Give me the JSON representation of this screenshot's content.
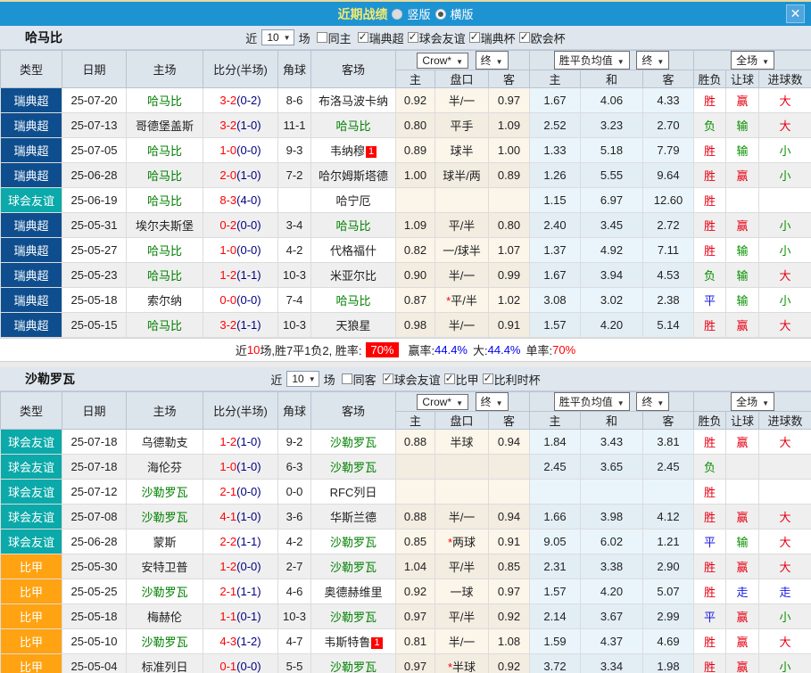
{
  "titlebar": {
    "title": "近期战绩",
    "vertical_label": "竖版",
    "horizontal_label": "横版",
    "selected_layout": "横版"
  },
  "icons": {
    "close": "✕",
    "dropdown_arrow": "▼",
    "checkbox_check": "✓"
  },
  "colors": {
    "bar_blue": "#1E93D2",
    "title_yellow": "#F5E96E",
    "section_bg": "#DFE6EE",
    "header_bg": "#DCE4EC",
    "red": "#FF0000",
    "blue": "#0000EE",
    "green": "#008000",
    "navy": "#000080"
  },
  "league_colors": {
    "瑞典超": "#0E4E8E",
    "球会友谊": "#0BA9A9",
    "比甲": "#FFA312"
  },
  "result_colors": {
    "胜": "#E60012",
    "平": "#1A1AE6",
    "负": "#089000",
    "赢": "#E60012",
    "输": "#089000",
    "走": "#1A1AE6",
    "大": "#E60012",
    "小": "#089000"
  },
  "sections": [
    {
      "team": "哈马比",
      "filter": {
        "near": "近",
        "count": "10",
        "games": "场",
        "same": "同主",
        "same_checked": false,
        "leagues": [
          "瑞典超",
          "球会友谊",
          "瑞典杯",
          "欧会杯"
        ],
        "leagues_checked": true
      },
      "header": {
        "cols": {
          "type": "类型",
          "date": "日期",
          "home": "主场",
          "score": "比分(半场)",
          "corner": "角球",
          "away": "客场"
        },
        "odds_source": "Crow*",
        "final": "终",
        "mean": "胜平负均值",
        "final2": "终",
        "full": "全场",
        "sub": {
          "oh": "主",
          "hc": "盘口",
          "oa": "客",
          "m1": "主",
          "m2": "和",
          "m3": "客",
          "r1": "胜负",
          "r2": "让球",
          "r3": "进球数"
        }
      },
      "rows": [
        {
          "league": "瑞典超",
          "date": "25-07-20",
          "home": "哈马比",
          "home_active": true,
          "score": "3-2",
          "half": "(0-2)",
          "corner": "8-6",
          "away": "布洛马波卡纳",
          "away_active": false,
          "away_badge": "",
          "odds": [
            "0.92",
            "半/一",
            "0.97"
          ],
          "means": [
            "1.67",
            "4.06",
            "4.33"
          ],
          "results": [
            "胜",
            "赢",
            "大"
          ]
        },
        {
          "league": "瑞典超",
          "date": "25-07-13",
          "home": "哥德堡盖斯",
          "home_active": false,
          "score": "3-2",
          "half": "(1-0)",
          "corner": "11-1",
          "away": "哈马比",
          "away_active": true,
          "away_badge": "",
          "odds": [
            "0.80",
            "平手",
            "1.09"
          ],
          "means": [
            "2.52",
            "3.23",
            "2.70"
          ],
          "results": [
            "负",
            "输",
            "大"
          ]
        },
        {
          "league": "瑞典超",
          "date": "25-07-05",
          "home": "哈马比",
          "home_active": true,
          "score": "1-0",
          "half": "(0-0)",
          "corner": "9-3",
          "away": "韦纳穆",
          "away_active": false,
          "away_badge": "1",
          "odds": [
            "0.89",
            "球半",
            "1.00"
          ],
          "means": [
            "1.33",
            "5.18",
            "7.79"
          ],
          "results": [
            "胜",
            "输",
            "小"
          ]
        },
        {
          "league": "瑞典超",
          "date": "25-06-28",
          "home": "哈马比",
          "home_active": true,
          "score": "2-0",
          "half": "(1-0)",
          "corner": "7-2",
          "away": "哈尔姆斯塔德",
          "away_active": false,
          "away_badge": "",
          "odds": [
            "1.00",
            "球半/两",
            "0.89"
          ],
          "means": [
            "1.26",
            "5.55",
            "9.64"
          ],
          "results": [
            "胜",
            "赢",
            "小"
          ]
        },
        {
          "league": "球会友谊",
          "date": "25-06-19",
          "home": "哈马比",
          "home_active": true,
          "score": "8-3",
          "half": "(4-0)",
          "corner": "",
          "away": "哈宁厄",
          "away_active": false,
          "away_badge": "",
          "odds": [
            "",
            "",
            ""
          ],
          "means": [
            "1.15",
            "6.97",
            "12.60"
          ],
          "results": [
            "胜",
            "",
            ""
          ]
        },
        {
          "league": "瑞典超",
          "date": "25-05-31",
          "home": "埃尔夫斯堡",
          "home_active": false,
          "score": "0-2",
          "half": "(0-0)",
          "corner": "3-4",
          "away": "哈马比",
          "away_active": true,
          "away_badge": "",
          "odds": [
            "1.09",
            "平/半",
            "0.80"
          ],
          "means": [
            "2.40",
            "3.45",
            "2.72"
          ],
          "results": [
            "胜",
            "赢",
            "小"
          ]
        },
        {
          "league": "瑞典超",
          "date": "25-05-27",
          "home": "哈马比",
          "home_active": true,
          "score": "1-0",
          "half": "(0-0)",
          "corner": "4-2",
          "away": "代格福什",
          "away_active": false,
          "away_badge": "",
          "odds": [
            "0.82",
            "一/球半",
            "1.07"
          ],
          "means": [
            "1.37",
            "4.92",
            "7.11"
          ],
          "results": [
            "胜",
            "输",
            "小"
          ]
        },
        {
          "league": "瑞典超",
          "date": "25-05-23",
          "home": "哈马比",
          "home_active": true,
          "score": "1-2",
          "half": "(1-1)",
          "corner": "10-3",
          "away": "米亚尔比",
          "away_active": false,
          "away_badge": "",
          "odds": [
            "0.90",
            "半/一",
            "0.99"
          ],
          "means": [
            "1.67",
            "3.94",
            "4.53"
          ],
          "results": [
            "负",
            "输",
            "大"
          ]
        },
        {
          "league": "瑞典超",
          "date": "25-05-18",
          "home": "索尔纳",
          "home_active": false,
          "score": "0-0",
          "half": "(0-0)",
          "corner": "7-4",
          "away": "哈马比",
          "away_active": true,
          "away_badge": "",
          "odds": [
            "0.87",
            "*平/半",
            "1.02"
          ],
          "means": [
            "3.08",
            "3.02",
            "2.38"
          ],
          "results": [
            "平",
            "输",
            "小"
          ]
        },
        {
          "league": "瑞典超",
          "date": "25-05-15",
          "home": "哈马比",
          "home_active": true,
          "score": "3-2",
          "half": "(1-1)",
          "corner": "10-3",
          "away": "天狼星",
          "away_active": false,
          "away_badge": "",
          "odds": [
            "0.98",
            "半/一",
            "0.91"
          ],
          "means": [
            "1.57",
            "4.20",
            "5.14"
          ],
          "results": [
            "胜",
            "赢",
            "大"
          ]
        }
      ],
      "summary": {
        "p1": "近",
        "count": "10",
        "p2": "场,胜7平1负2, 胜率:",
        "win_rate": "70%",
        "l2": "赢率:",
        "v2": "44.4%",
        "l3": "大:",
        "v3": "44.4%",
        "l4": "单率:",
        "v4": "70%"
      }
    },
    {
      "team": "沙勒罗瓦",
      "filter": {
        "near": "近",
        "count": "10",
        "games": "场",
        "same": "同客",
        "same_checked": false,
        "leagues": [
          "球会友谊",
          "比甲",
          "比利时杯"
        ],
        "leagues_checked": true
      },
      "header": {
        "cols": {
          "type": "类型",
          "date": "日期",
          "home": "主场",
          "score": "比分(半场)",
          "corner": "角球",
          "away": "客场"
        },
        "odds_source": "Crow*",
        "final": "终",
        "mean": "胜平负均值",
        "final2": "终",
        "full": "全场",
        "sub": {
          "oh": "主",
          "hc": "盘口",
          "oa": "客",
          "m1": "主",
          "m2": "和",
          "m3": "客",
          "r1": "胜负",
          "r2": "让球",
          "r3": "进球数"
        }
      },
      "rows": [
        {
          "league": "球会友谊",
          "date": "25-07-18",
          "home": "乌德勒支",
          "home_active": false,
          "score": "1-2",
          "half": "(1-0)",
          "corner": "9-2",
          "away": "沙勒罗瓦",
          "away_active": true,
          "away_badge": "",
          "odds": [
            "0.88",
            "半球",
            "0.94"
          ],
          "means": [
            "1.84",
            "3.43",
            "3.81"
          ],
          "results": [
            "胜",
            "赢",
            "大"
          ]
        },
        {
          "league": "球会友谊",
          "date": "25-07-18",
          "home": "海伦芬",
          "home_active": false,
          "score": "1-0",
          "half": "(1-0)",
          "corner": "6-3",
          "away": "沙勒罗瓦",
          "away_active": true,
          "away_badge": "",
          "odds": [
            "",
            "",
            ""
          ],
          "means": [
            "2.45",
            "3.65",
            "2.45"
          ],
          "results": [
            "负",
            "",
            ""
          ]
        },
        {
          "league": "球会友谊",
          "date": "25-07-12",
          "home": "沙勒罗瓦",
          "home_active": true,
          "score": "2-1",
          "half": "(0-0)",
          "corner": "0-0",
          "away": "RFC列日",
          "away_active": false,
          "away_badge": "",
          "odds": [
            "",
            "",
            ""
          ],
          "means": [
            "",
            "",
            ""
          ],
          "results": [
            "胜",
            "",
            ""
          ]
        },
        {
          "league": "球会友谊",
          "date": "25-07-08",
          "home": "沙勒罗瓦",
          "home_active": true,
          "score": "4-1",
          "half": "(1-0)",
          "corner": "3-6",
          "away": "华斯兰德",
          "away_active": false,
          "away_badge": "",
          "odds": [
            "0.88",
            "半/一",
            "0.94"
          ],
          "means": [
            "1.66",
            "3.98",
            "4.12"
          ],
          "results": [
            "胜",
            "赢",
            "大"
          ]
        },
        {
          "league": "球会友谊",
          "date": "25-06-28",
          "home": "蒙斯",
          "home_active": false,
          "score": "2-2",
          "half": "(1-1)",
          "corner": "4-2",
          "away": "沙勒罗瓦",
          "away_active": true,
          "away_badge": "",
          "odds": [
            "0.85",
            "*两球",
            "0.91"
          ],
          "means": [
            "9.05",
            "6.02",
            "1.21"
          ],
          "results": [
            "平",
            "输",
            "大"
          ]
        },
        {
          "league": "比甲",
          "date": "25-05-30",
          "home": "安特卫普",
          "home_active": false,
          "score": "1-2",
          "half": "(0-0)",
          "corner": "2-7",
          "away": "沙勒罗瓦",
          "away_active": true,
          "away_badge": "",
          "odds": [
            "1.04",
            "平/半",
            "0.85"
          ],
          "means": [
            "2.31",
            "3.38",
            "2.90"
          ],
          "results": [
            "胜",
            "赢",
            "大"
          ]
        },
        {
          "league": "比甲",
          "date": "25-05-25",
          "home": "沙勒罗瓦",
          "home_active": true,
          "score": "2-1",
          "half": "(1-1)",
          "corner": "4-6",
          "away": "奥德赫维里",
          "away_active": false,
          "away_badge": "",
          "odds": [
            "0.92",
            "一球",
            "0.97"
          ],
          "means": [
            "1.57",
            "4.20",
            "5.07"
          ],
          "results": [
            "胜",
            "走",
            "走"
          ]
        },
        {
          "league": "比甲",
          "date": "25-05-18",
          "home": "梅赫伦",
          "home_active": false,
          "score": "1-1",
          "half": "(0-1)",
          "corner": "10-3",
          "away": "沙勒罗瓦",
          "away_active": true,
          "away_badge": "",
          "odds": [
            "0.97",
            "平/半",
            "0.92"
          ],
          "means": [
            "2.14",
            "3.67",
            "2.99"
          ],
          "results": [
            "平",
            "赢",
            "小"
          ]
        },
        {
          "league": "比甲",
          "date": "25-05-10",
          "home": "沙勒罗瓦",
          "home_active": true,
          "score": "4-3",
          "half": "(1-2)",
          "corner": "4-7",
          "away": "韦斯特鲁",
          "away_active": false,
          "away_badge": "1",
          "odds": [
            "0.81",
            "半/一",
            "1.08"
          ],
          "means": [
            "1.59",
            "4.37",
            "4.69"
          ],
          "results": [
            "胜",
            "赢",
            "大"
          ]
        },
        {
          "league": "比甲",
          "date": "25-05-04",
          "home": "标准列日",
          "home_active": false,
          "score": "0-1",
          "half": "(0-0)",
          "corner": "5-5",
          "away": "沙勒罗瓦",
          "away_active": true,
          "away_badge": "",
          "odds": [
            "0.97",
            "*半球",
            "0.92"
          ],
          "means": [
            "3.72",
            "3.34",
            "1.98"
          ],
          "results": [
            "胜",
            "赢",
            "小"
          ]
        }
      ]
    }
  ]
}
